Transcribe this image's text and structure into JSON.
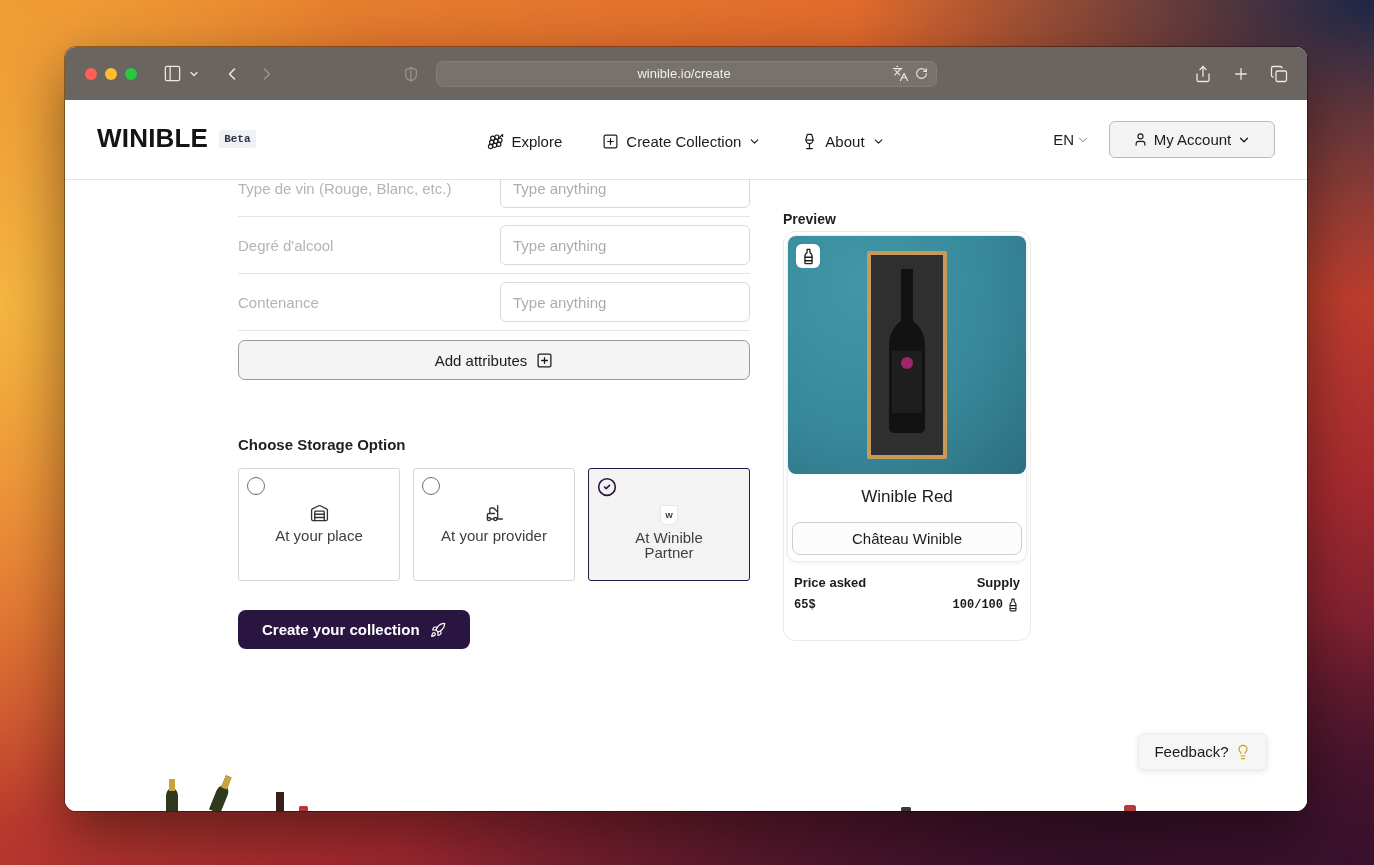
{
  "browser": {
    "url": "winible.io/create"
  },
  "header": {
    "logo": "WINIBLE",
    "badge": "Beta",
    "nav": [
      {
        "label": "Explore",
        "kind": "link"
      },
      {
        "label": "Create Collection",
        "kind": "menu"
      },
      {
        "label": "About",
        "kind": "menu"
      }
    ],
    "language": "EN",
    "account": "My Account"
  },
  "attributes": [
    {
      "label": "Type de vin (Rouge, Blanc, etc.)",
      "placeholder": "Type anything"
    },
    {
      "label": "Degré d'alcool",
      "placeholder": "Type anything"
    },
    {
      "label": "Contenance",
      "placeholder": "Type anything"
    }
  ],
  "add_attributes": "Add attributes",
  "storage": {
    "title": "Choose Storage Option",
    "options": [
      {
        "label": "At your place",
        "selected": false
      },
      {
        "label": "At your provider",
        "selected": false
      },
      {
        "label": "At Winible Partner",
        "selected": true
      }
    ],
    "partner_logo": "W"
  },
  "create_button": "Create your collection",
  "preview": {
    "title": "Preview",
    "name": "Winible Red",
    "producer": "Château Winible",
    "price_label": "Price asked",
    "price": "65$",
    "supply_label": "Supply",
    "supply": "100/100"
  },
  "feedback": "Feedback?"
}
